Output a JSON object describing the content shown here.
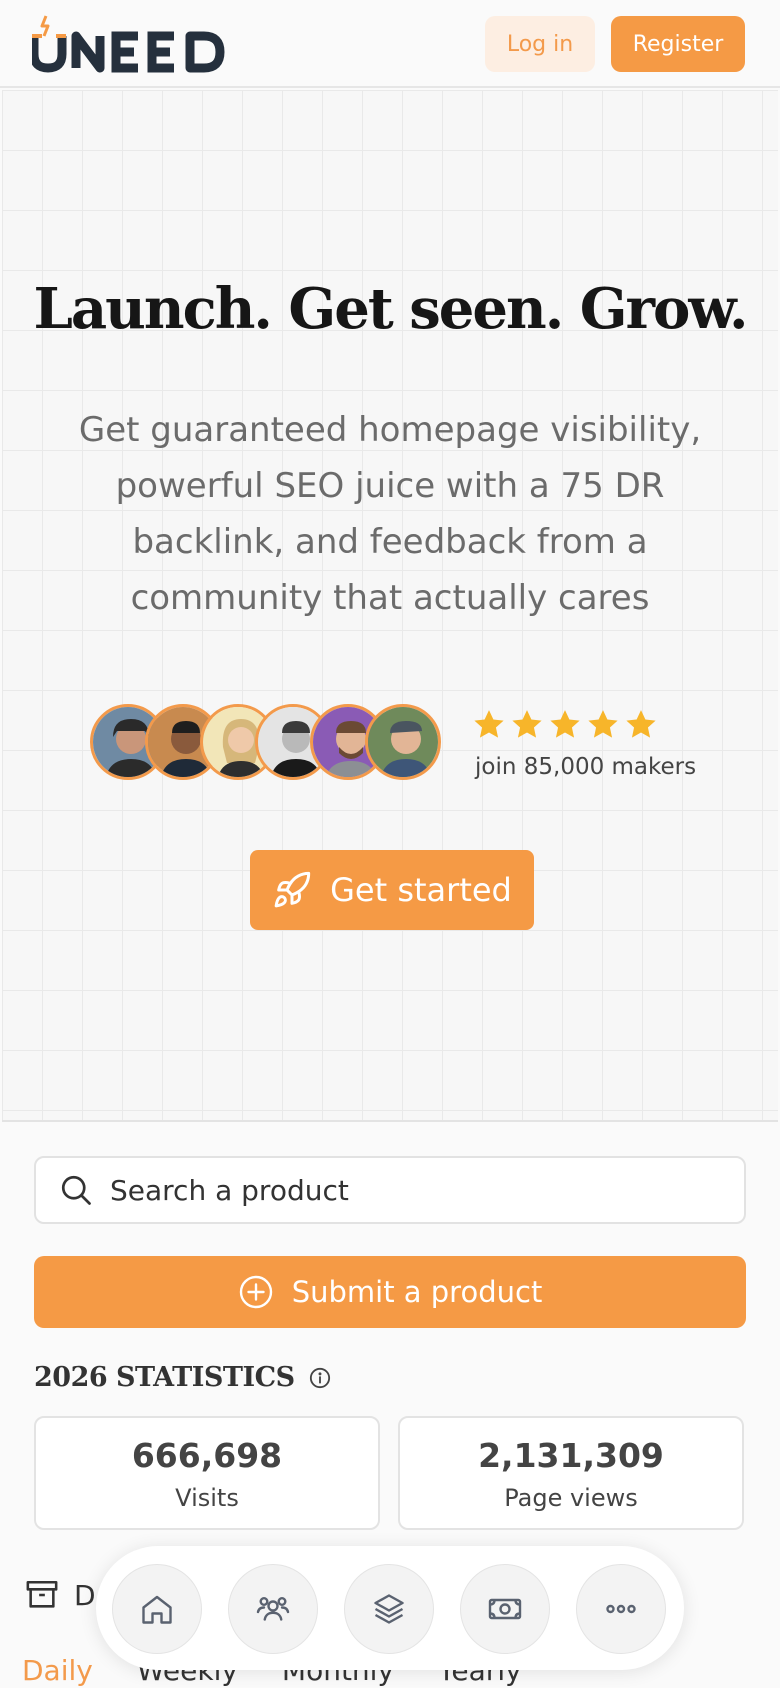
{
  "header": {
    "brand": "UNEED",
    "login_label": "Log in",
    "register_label": "Register"
  },
  "hero": {
    "title": "Launch. Get seen. Grow.",
    "subtitle": "Get guaranteed homepage visibility, powerful SEO juice with a 75 DR backlink, and feedback from a community that actually cares",
    "rating_stars": 5,
    "makers_text": "join 85,000 makers",
    "cta_label": "Get started"
  },
  "search": {
    "placeholder": "Search a product"
  },
  "submit": {
    "label": "Submit a product"
  },
  "stats": {
    "title": "2026 STATISTICS",
    "cards": [
      {
        "value": "666,698",
        "label": "Visits"
      },
      {
        "value": "2,131,309",
        "label": "Page views"
      }
    ]
  },
  "section": {
    "archive_label": "D"
  },
  "tabs": [
    {
      "label": "Daily",
      "active": true
    },
    {
      "label": "Weekly",
      "active": false
    },
    {
      "label": "Monthly",
      "active": false
    },
    {
      "label": "Yearly",
      "active": false
    }
  ],
  "bottom_nav": [
    "home-icon",
    "community-icon",
    "layers-icon",
    "money-icon",
    "more-icon"
  ],
  "colors": {
    "accent": "#f59a45",
    "accent_light": "#fdeee2",
    "star": "#f7b52a"
  }
}
